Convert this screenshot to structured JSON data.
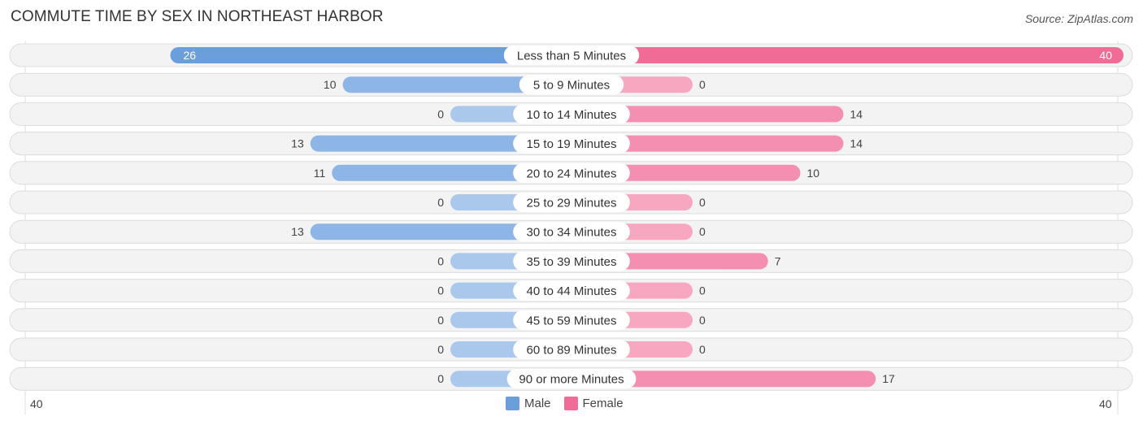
{
  "title": "COMMUTE TIME BY SEX IN NORTHEAST HARBOR",
  "source": "Source: ZipAtlas.com",
  "colors": {
    "male": "#6a9fdb",
    "male_light": "#a9c8ec",
    "female": "#f06b95",
    "female_light": "#f7a7c0"
  },
  "legend": {
    "male": "Male",
    "female": "Female"
  },
  "axis": {
    "left": "40",
    "right": "40"
  },
  "chart_data": {
    "type": "bar",
    "orientation": "horizontal-diverging",
    "title": "COMMUTE TIME BY SEX IN NORTHEAST HARBOR",
    "categories": [
      "Less than 5 Minutes",
      "5 to 9 Minutes",
      "10 to 14 Minutes",
      "15 to 19 Minutes",
      "20 to 24 Minutes",
      "25 to 29 Minutes",
      "30 to 34 Minutes",
      "35 to 39 Minutes",
      "40 to 44 Minutes",
      "45 to 59 Minutes",
      "60 to 89 Minutes",
      "90 or more Minutes"
    ],
    "series": [
      {
        "name": "Male",
        "values": [
          26,
          10,
          0,
          13,
          11,
          0,
          13,
          0,
          0,
          0,
          0,
          0
        ]
      },
      {
        "name": "Female",
        "values": [
          40,
          0,
          14,
          14,
          10,
          0,
          0,
          7,
          0,
          0,
          0,
          17
        ]
      }
    ],
    "xlim": [
      40,
      40
    ],
    "legend": "bottom-center"
  }
}
